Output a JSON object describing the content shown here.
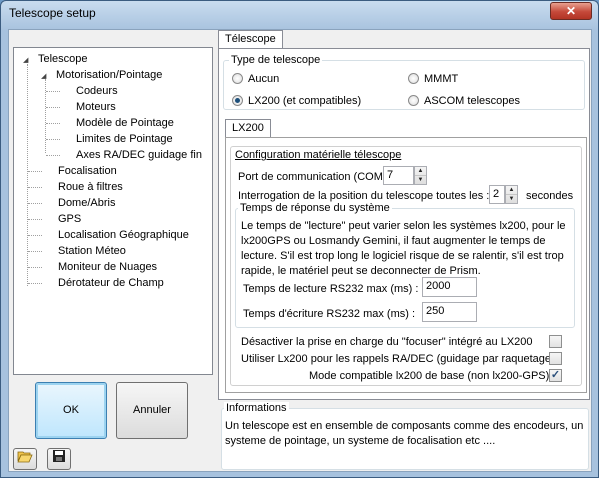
{
  "window": {
    "title": "Telescope setup",
    "close_label": "✕"
  },
  "tree": {
    "root": "Telescope",
    "motorisation": "Motorisation/Pointage",
    "codeurs": "Codeurs",
    "moteurs": "Moteurs",
    "modele": "Modèle de Pointage",
    "limites": "Limites de Pointage",
    "axes": "Axes RA/DEC guidage fin",
    "focalisation": "Focalisation",
    "roue": "Roue à filtres",
    "dome": "Dome/Abris",
    "gps": "GPS",
    "localisation": "Localisation Géographique",
    "station": "Station Méteo",
    "moniteur": "Moniteur de Nuages",
    "derotateur": "Dérotateur de Champ"
  },
  "buttons": {
    "ok": "OK",
    "cancel": "Annuler"
  },
  "tabs": {
    "telescope": "Télescope",
    "lx200": "LX200"
  },
  "type": {
    "title": "Type de telescope",
    "aucun": "Aucun",
    "mmmt": "MMMT",
    "lx200": "LX200 (et compatibles)",
    "ascom": "ASCOM telescopes",
    "selected": "lx200"
  },
  "config": {
    "title": "Configuration matérielle télescope",
    "port_label": "Port de communication (COM) :",
    "port_value": "7",
    "interro_label": "Interrogation de la position du telescope  toutes les :",
    "interro_value": "2",
    "interro_unit": "secondes"
  },
  "response": {
    "title": "Temps de réponse du système",
    "text": "Le temps de \"lecture\" peut varier selon les systèmes lx200, pour le lx200GPS ou Losmandy Gemini, il faut augmenter le temps de lecture. S'il est trop long le logiciel risque de se ralentir, s'il est trop rapide, le matériel peut se deconnecter de Prism.",
    "read_label": "Temps de lecture RS232 max (ms) :",
    "read_value": "2000",
    "write_label": "Temps d'écriture RS232 max (ms) :",
    "write_value": "250"
  },
  "options": {
    "opt1": "Désactiver la prise en charge du \"focuser\" intégré au LX200",
    "opt2": "Utiliser Lx200 pour les rappels RA/DEC (guidage par raquetage)",
    "opt3": "Mode compatible lx200 de base (non lx200-GPS)",
    "opt1_checked": false,
    "opt2_checked": false,
    "opt3_checked": true
  },
  "info": {
    "title": "Informations",
    "text": "Un telescope est en ensemble de composants comme des encodeurs, un systeme de pointage, un systeme de focalisation etc ...."
  }
}
